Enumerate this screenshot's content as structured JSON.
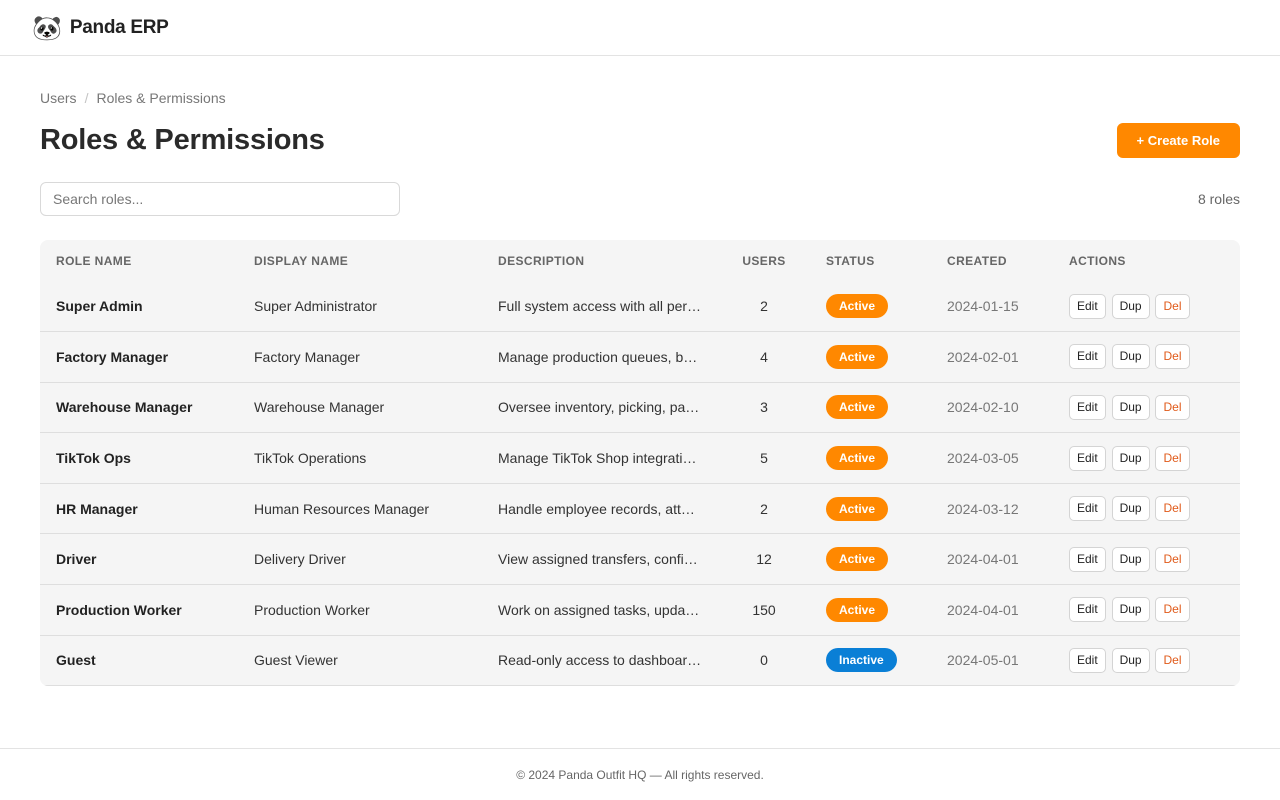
{
  "app": {
    "logo_glyph": "🐼",
    "logo_icon": "panda-icon",
    "name": "Panda ERP"
  },
  "breadcrumb": {
    "items": [
      "Users",
      "Roles & Permissions"
    ],
    "separator": "/"
  },
  "page": {
    "title": "Roles & Permissions",
    "create_label": "+ Create Role"
  },
  "search": {
    "placeholder": "Search roles...",
    "value": ""
  },
  "summary": {
    "count_label": "8 roles"
  },
  "table": {
    "columns": [
      "ROLE NAME",
      "DISPLAY NAME",
      "DESCRIPTION",
      "USERS",
      "STATUS",
      "CREATED",
      "ACTIONS"
    ],
    "actions": {
      "edit": "Edit",
      "dup": "Dup",
      "del": "Del"
    },
    "rows": [
      {
        "role": "Super Admin",
        "display": "Super Administrator",
        "description": "Full system access with all per…",
        "users": "2",
        "status": "Active",
        "created": "2024-01-15"
      },
      {
        "role": "Factory Manager",
        "display": "Factory Manager",
        "description": "Manage production queues, b…",
        "users": "4",
        "status": "Active",
        "created": "2024-02-01"
      },
      {
        "role": "Warehouse Manager",
        "display": "Warehouse Manager",
        "description": "Oversee inventory, picking, pa…",
        "users": "3",
        "status": "Active",
        "created": "2024-02-10"
      },
      {
        "role": "TikTok Ops",
        "display": "TikTok Operations",
        "description": "Manage TikTok Shop integrati…",
        "users": "5",
        "status": "Active",
        "created": "2024-03-05"
      },
      {
        "role": "HR Manager",
        "display": "Human Resources Manager",
        "description": "Handle employee records, att…",
        "users": "2",
        "status": "Active",
        "created": "2024-03-12"
      },
      {
        "role": "Driver",
        "display": "Delivery Driver",
        "description": "View assigned transfers, confi…",
        "users": "12",
        "status": "Active",
        "created": "2024-04-01"
      },
      {
        "role": "Production Worker",
        "display": "Production Worker",
        "description": "Work on assigned tasks, upda…",
        "users": "150",
        "status": "Active",
        "created": "2024-04-01"
      },
      {
        "role": "Guest",
        "display": "Guest Viewer",
        "description": "Read-only access to dashboar…",
        "users": "0",
        "status": "Inactive",
        "created": "2024-05-01"
      }
    ]
  },
  "colors": {
    "accent": "#ff8800",
    "inactive": "#0a7fd6",
    "danger": "#e05a1a"
  },
  "footer": {
    "text": "© 2024 Panda Outfit HQ — All rights reserved."
  }
}
